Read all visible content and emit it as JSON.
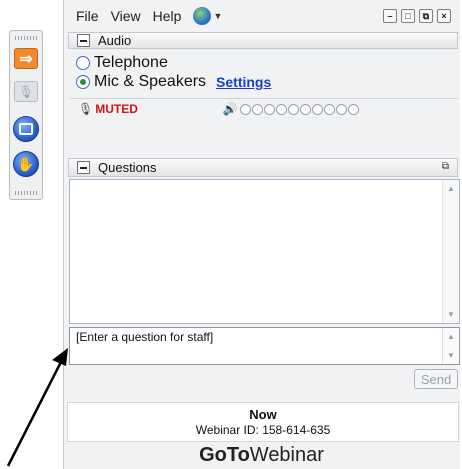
{
  "menubar": {
    "file": "File",
    "view": "View",
    "help": "Help",
    "globe_icon": "globe-icon",
    "window_buttons": [
      "minimize",
      "restore",
      "popout",
      "close"
    ]
  },
  "toolbar": {
    "icons": [
      "grip-icon",
      "arrow-right-icon",
      "microphone-icon",
      "screen-icon",
      "raise-hand-icon",
      "grip-icon"
    ]
  },
  "audio": {
    "title": "Audio",
    "telephone": "Telephone",
    "mic_speakers": "Mic & Speakers",
    "settings": "Settings",
    "selected": "Mic & Speakers",
    "status": "MUTED",
    "volume_dots": 10
  },
  "questions": {
    "title": "Questions",
    "input_placeholder": "[Enter a question for staff]",
    "send": "Send"
  },
  "info": {
    "now": "Now",
    "webinar_id": "Webinar ID: 158-614-635"
  },
  "brand": {
    "go": "GoTo",
    "webinar": "Webinar"
  },
  "colors": {
    "muted": "#d21414",
    "link": "#1a3fc7",
    "toolbar_orange": "#f08a2c",
    "toolbar_blue": "#1f55c4"
  }
}
